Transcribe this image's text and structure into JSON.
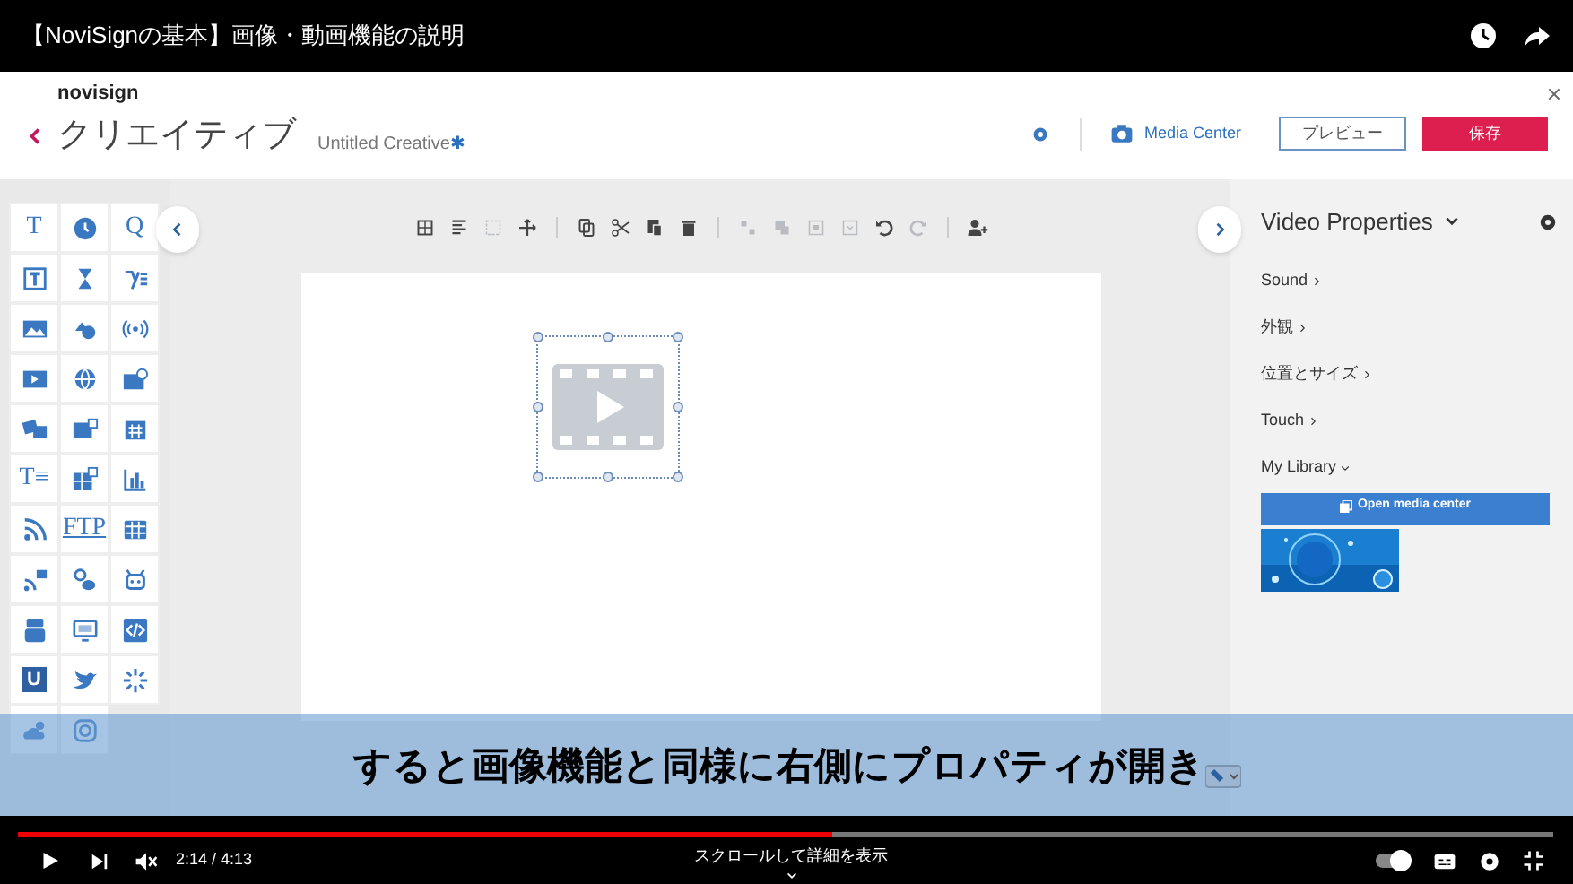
{
  "video_title": "【NoviSignの基本】画像・動画機能の説明",
  "app": {
    "logo": "novisign",
    "back_title": "クリエイティブ",
    "document_name": "Untitled Creative",
    "unsaved_mark": "✱",
    "media_center": "Media Center",
    "preview_button": "プレビュー",
    "save_button": "保存"
  },
  "palette": [
    {
      "kind": "glyph",
      "text": "T"
    },
    {
      "kind": "icon"
    },
    {
      "kind": "glyph",
      "text": "Q"
    },
    {
      "kind": "icon"
    },
    {
      "kind": "icon"
    },
    {
      "kind": "icon"
    },
    {
      "kind": "icon"
    },
    {
      "kind": "icon"
    },
    {
      "kind": "icon"
    },
    {
      "kind": "icon"
    },
    {
      "kind": "icon"
    },
    {
      "kind": "icon"
    },
    {
      "kind": "icon"
    },
    {
      "kind": "icon"
    },
    {
      "kind": "icon"
    },
    {
      "kind": "glyph",
      "text": "T≡"
    },
    {
      "kind": "icon"
    },
    {
      "kind": "icon"
    },
    {
      "kind": "icon"
    },
    {
      "kind": "glyph",
      "text": "FTP"
    },
    {
      "kind": "icon"
    },
    {
      "kind": "icon"
    },
    {
      "kind": "icon"
    },
    {
      "kind": "icon"
    },
    {
      "kind": "icon"
    },
    {
      "kind": "icon"
    },
    {
      "kind": "icon"
    },
    {
      "kind": "badge",
      "text": "U"
    },
    {
      "kind": "icon"
    },
    {
      "kind": "icon"
    },
    {
      "kind": "icon"
    },
    {
      "kind": "icon"
    }
  ],
  "toolbar": [
    {
      "disabled": false
    },
    {
      "disabled": false
    },
    {
      "disabled": true
    },
    {
      "disabled": false
    },
    {
      "disabled": false
    },
    {
      "disabled": false
    },
    {
      "disabled": false
    },
    {
      "disabled": false
    },
    {
      "disabled": true
    },
    {
      "disabled": true
    },
    {
      "disabled": true
    },
    {
      "disabled": true
    },
    {
      "disabled": false
    },
    {
      "disabled": true
    },
    {
      "disabled": false
    }
  ],
  "properties": {
    "title": "Video Properties",
    "sections": [
      {
        "label": "Sound",
        "expanded": false
      },
      {
        "label": "外観",
        "expanded": false
      },
      {
        "label": "位置とサイズ",
        "expanded": false
      },
      {
        "label": "Touch",
        "expanded": false
      },
      {
        "label": "My Library",
        "expanded": true
      }
    ],
    "open_media_button": "Open media center"
  },
  "subtitle": "すると画像機能と同様に右側にプロパティが開き",
  "player": {
    "level": 0.53,
    "time": "2:14 / 4:13",
    "scroll_hint": "スクロールして詳細を表示",
    "autoplay_on": true
  }
}
